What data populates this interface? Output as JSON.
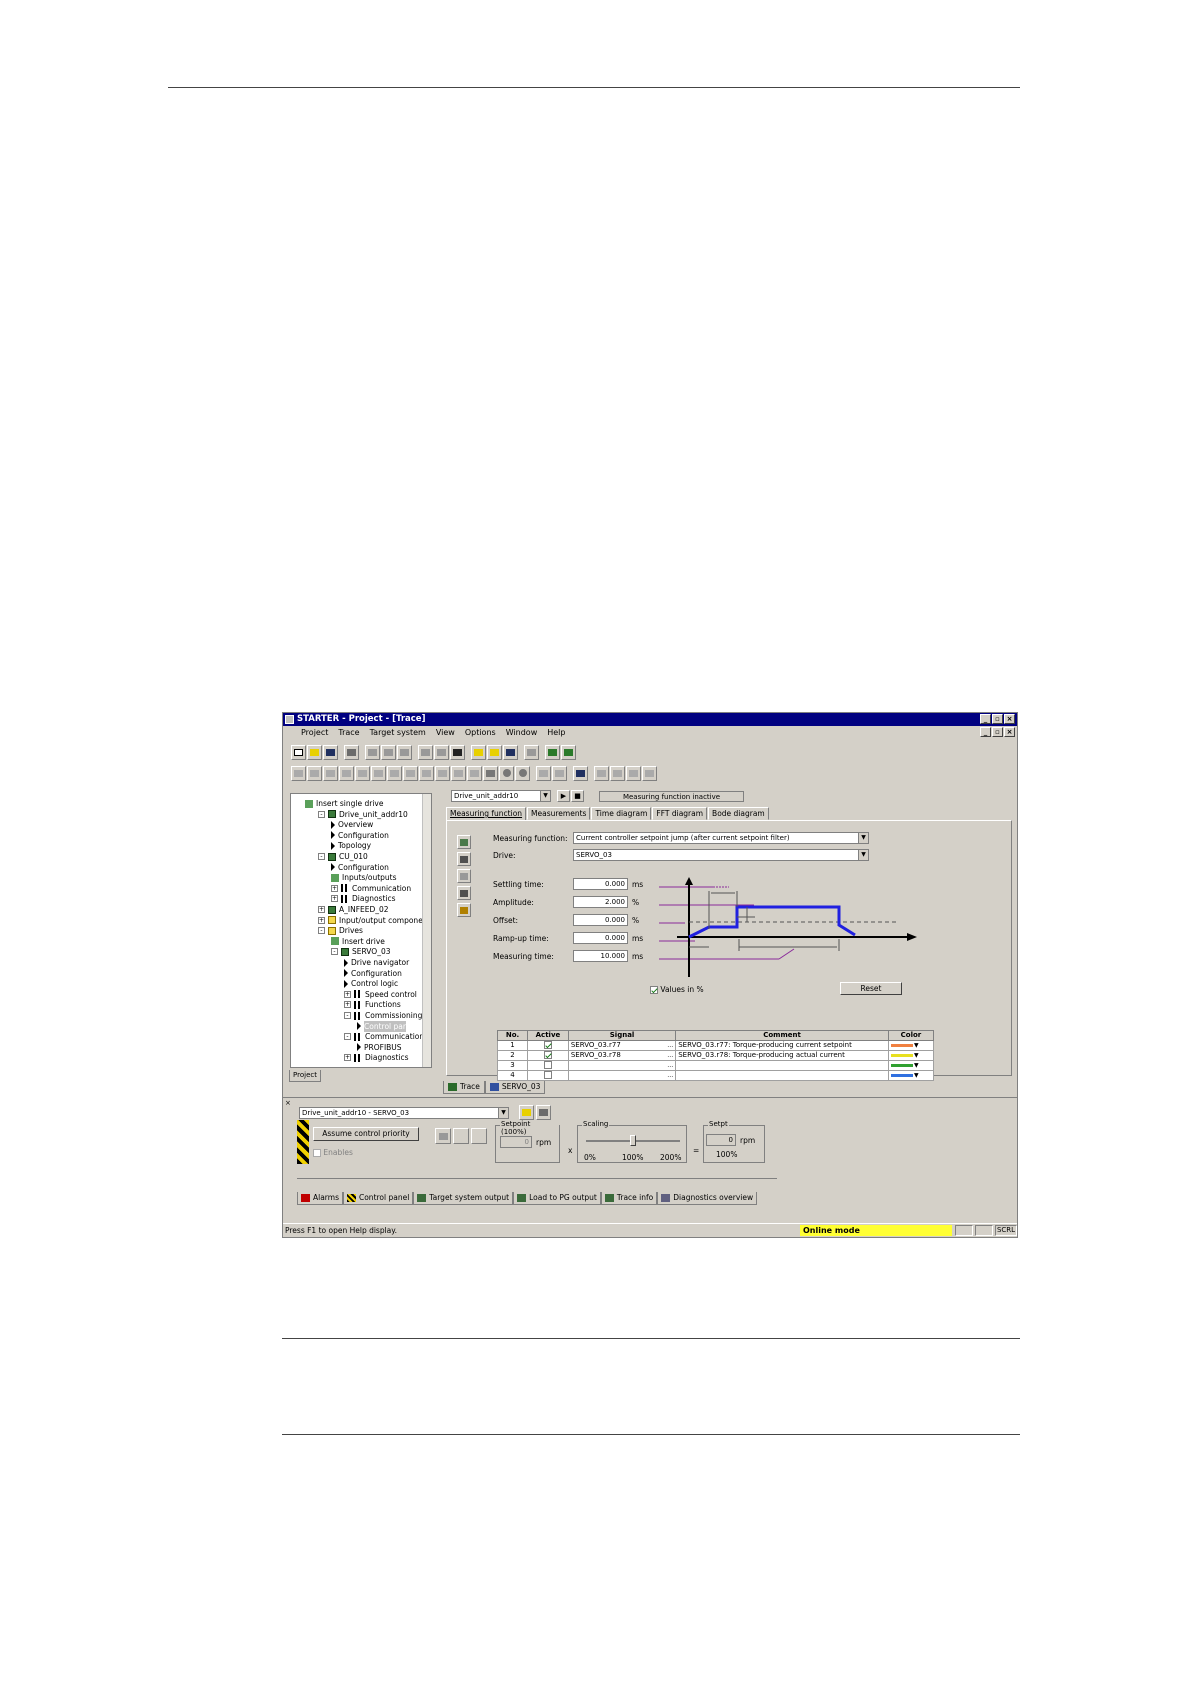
{
  "window": {
    "title": "STARTER - Project - [Trace]",
    "menu": [
      "Project",
      "Trace",
      "Target system",
      "View",
      "Options",
      "Window",
      "Help"
    ]
  },
  "tree": {
    "items": [
      {
        "label": "Insert single drive",
        "icon": "insert-drive-icon"
      },
      {
        "label": "Drive_unit_addr10",
        "icon": "drive-unit-icon",
        "expander": "-"
      },
      {
        "label": "Overview",
        "icon": "arrow-icon"
      },
      {
        "label": "Configuration",
        "icon": "arrow-icon"
      },
      {
        "label": "Topology",
        "icon": "arrow-icon"
      },
      {
        "label": "CU_010",
        "icon": "control-unit-icon",
        "expander": "-"
      },
      {
        "label": "Configuration",
        "icon": "arrow-icon"
      },
      {
        "label": "Inputs/outputs",
        "icon": "io-icon"
      },
      {
        "label": "Communication",
        "icon": "double-arrow-icon",
        "expander": "+"
      },
      {
        "label": "Diagnostics",
        "icon": "double-arrow-icon",
        "expander": "+"
      },
      {
        "label": "A_INFEED_02",
        "icon": "infeed-icon",
        "expander": "+"
      },
      {
        "label": "Input/output componer",
        "icon": "folder-icon",
        "expander": "+"
      },
      {
        "label": "Drives",
        "icon": "folder-icon",
        "expander": "-"
      },
      {
        "label": "Insert drive",
        "icon": "insert-drive-icon"
      },
      {
        "label": "SERVO_03",
        "icon": "servo-icon",
        "expander": "-"
      },
      {
        "label": "Drive navigator",
        "icon": "arrow-icon"
      },
      {
        "label": "Configuration",
        "icon": "arrow-icon"
      },
      {
        "label": "Control logic",
        "icon": "arrow-icon"
      },
      {
        "label": "Speed control",
        "icon": "double-arrow-icon",
        "expander": "+"
      },
      {
        "label": "Functions",
        "icon": "double-arrow-icon",
        "expander": "+"
      },
      {
        "label": "Commissioning",
        "icon": "double-arrow-icon",
        "expander": "-"
      },
      {
        "label": "Control par",
        "icon": "arrow-icon",
        "selected": true
      },
      {
        "label": "Communication",
        "icon": "double-arrow-icon",
        "expander": "-"
      },
      {
        "label": "PROFIBUS",
        "icon": "arrow-icon"
      },
      {
        "label": "Diagnostics",
        "icon": "double-arrow-icon",
        "expander": "+"
      }
    ],
    "tab": "Project"
  },
  "trace": {
    "drive_unit": "Drive_unit_addr10",
    "status": "Measuring function inactive",
    "tabs": [
      "Measuring function",
      "Measurements",
      "Time diagram",
      "FFT diagram",
      "Bode diagram"
    ],
    "measuring_function_label": "Measuring function:",
    "measuring_function_value": "Current controller setpoint jump (after current setpoint filter)",
    "drive_label": "Drive:",
    "drive_value": "SERVO_03",
    "params": [
      {
        "label": "Settling time:",
        "value": "0.000",
        "unit": "ms"
      },
      {
        "label": "Amplitude:",
        "value": "2.000",
        "unit": "%"
      },
      {
        "label": "Offset:",
        "value": "0.000",
        "unit": "%"
      },
      {
        "label": "Ramp-up time:",
        "value": "0.000",
        "unit": "ms"
      },
      {
        "label": "Measuring time:",
        "value": "10.000",
        "unit": "ms"
      }
    ],
    "values_in_percent": "Values in %",
    "reset": "Reset",
    "table": {
      "headers": [
        "No.",
        "Active",
        "Signal",
        "Comment",
        "Color"
      ],
      "rows": [
        {
          "no": "1",
          "active": true,
          "signal": "SERVO_03.r77",
          "comment": "SERVO_03.r77: Torque-producing current setpoint",
          "color": "#f08040"
        },
        {
          "no": "2",
          "active": true,
          "signal": "SERVO_03.r78",
          "comment": "SERVO_03.r78: Torque-producing actual current",
          "color": "#e8e020"
        },
        {
          "no": "3",
          "active": false,
          "signal": "",
          "comment": "",
          "color": "#30a030"
        },
        {
          "no": "4",
          "active": false,
          "signal": "",
          "comment": "",
          "color": "#3070e0"
        }
      ]
    },
    "bottom_tabs": [
      "Trace",
      "SERVO_03"
    ]
  },
  "control_panel": {
    "drive_select": "Drive_unit_addr10 - SERVO_03",
    "assume_priority": "Assume control priority",
    "enables": "Enables",
    "setpoint_title": "Setpoint (100%)",
    "setpoint_value": "0",
    "setpoint_unit": "rpm",
    "times": "x",
    "scaling_title": "Scaling",
    "scale_ticks": [
      "0%",
      "100%",
      "200%"
    ],
    "scaling_level_percent": 100,
    "equals": "=",
    "setpt_title": "Setpt",
    "setpt_value": "0",
    "setpt_unit": "rpm",
    "setpt_percent": "100%"
  },
  "lower_tabs": [
    "Alarms",
    "Control panel",
    "Target system output",
    "Load to PG output",
    "Trace info",
    "Diagnostics overview"
  ],
  "statusbar": {
    "help": "Press F1 to open Help display.",
    "mode": "Online mode",
    "scrl": "SCRL"
  }
}
